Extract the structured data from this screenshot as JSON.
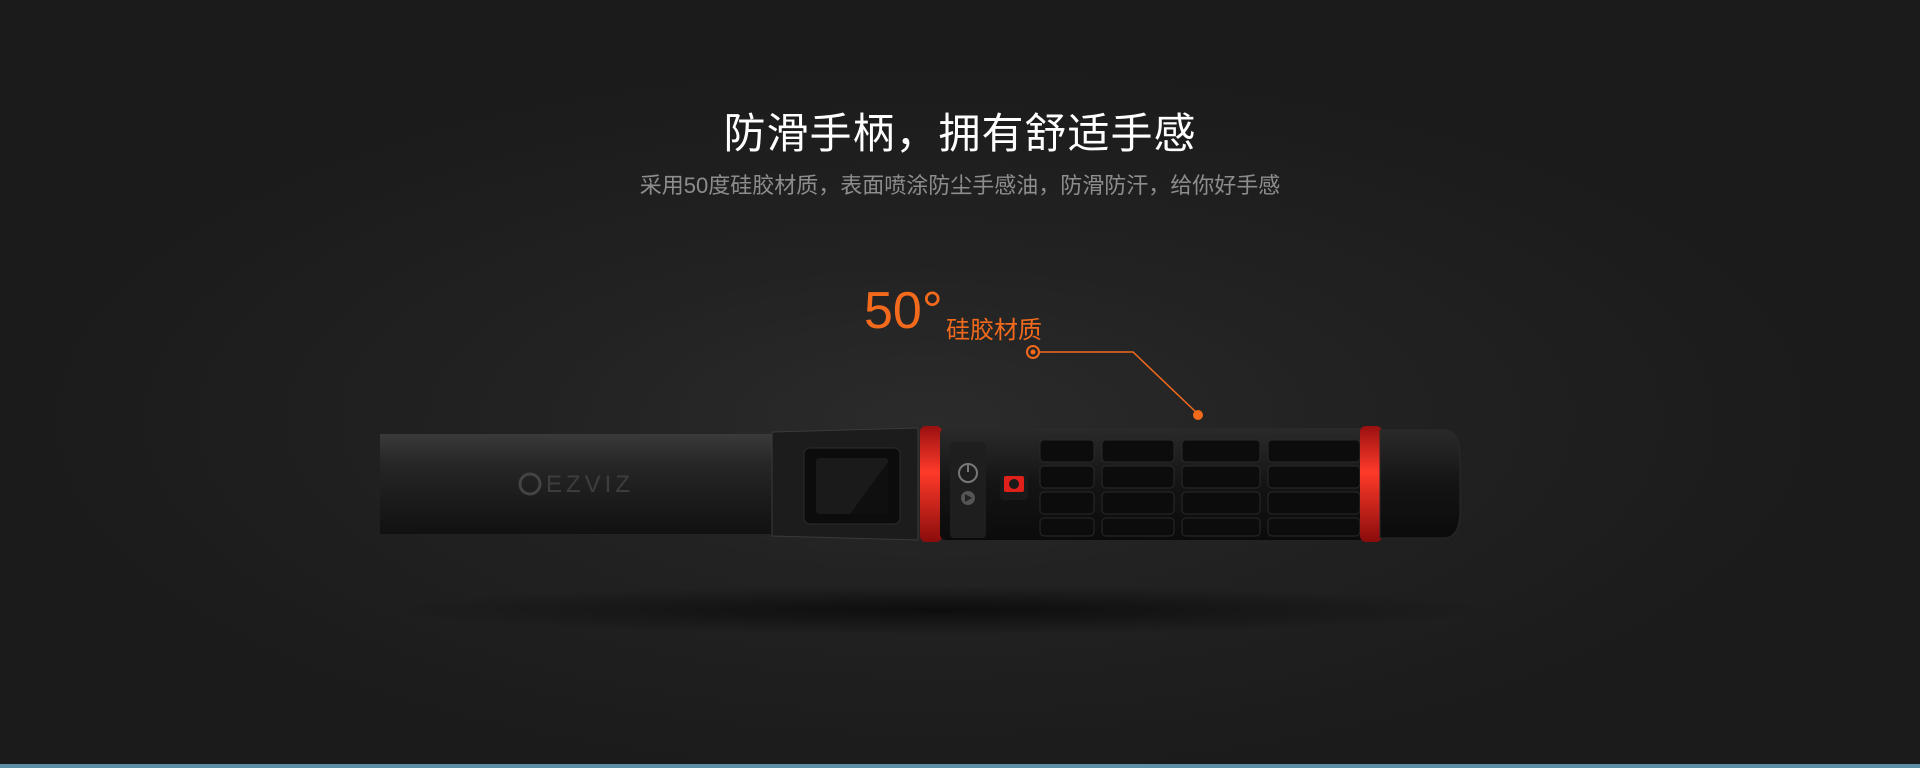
{
  "heading": "防滑手柄，拥有舒适手感",
  "subheading": "采用50度硅胶材质，表面喷涂防尘手感油，防滑防汗，给你好手感",
  "callout": {
    "degree": "50°",
    "label": "硅胶材质"
  },
  "product": {
    "brand_logo": "EZVIZ"
  },
  "colors": {
    "accent": "#f36a1c",
    "ring": "#e0201a",
    "background": "#1b1b1b",
    "bottom_bar": "#5b8fa8"
  }
}
